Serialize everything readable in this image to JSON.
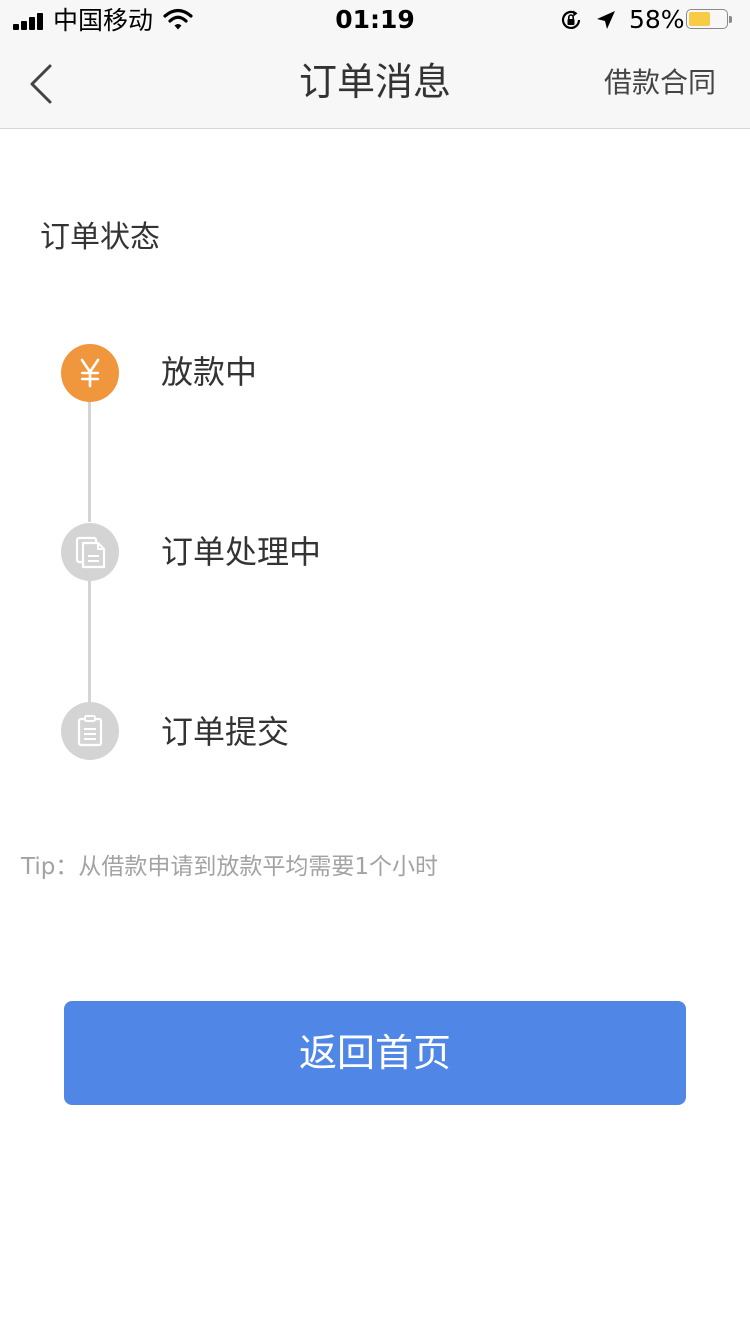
{
  "status_bar": {
    "carrier": "中国移动",
    "time": "01:19",
    "battery_percent": "58%",
    "battery_level": 0.58,
    "icons": [
      "signal-icon",
      "wifi-icon",
      "rotation-lock-icon",
      "location-arrow-icon",
      "battery-icon"
    ]
  },
  "nav": {
    "back_icon": "chevron-left-icon",
    "title": "订单消息",
    "right_link": "借款合同"
  },
  "order_status": {
    "section_title": "订单状态",
    "steps": [
      {
        "label": "放款中",
        "icon": "yuan-icon",
        "active": true,
        "color": "#f0963c"
      },
      {
        "label": "订单处理中",
        "icon": "documents-icon",
        "active": false,
        "color": "#d4d4d4"
      },
      {
        "label": "订单提交",
        "icon": "clipboard-icon",
        "active": false,
        "color": "#d4d4d4"
      }
    ]
  },
  "tip": "Tip：从借款申请到放款平均需要1个小时",
  "primary_button": {
    "label": "返回首页",
    "color": "#5087e6"
  }
}
